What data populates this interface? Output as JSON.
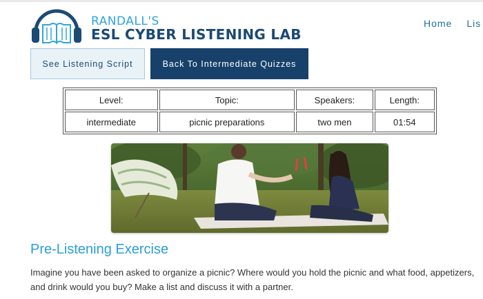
{
  "brand": {
    "top_line": "RANDALL'S",
    "main_line": "ESL CYBER LISTENING LAB"
  },
  "nav": {
    "items": [
      "Home",
      "Lis"
    ]
  },
  "buttons": {
    "script_label": "See Listening Script",
    "back_label": "Back To Intermediate Quizzes"
  },
  "info_table": {
    "headers": [
      "Level:",
      "Topic:",
      "Speakers:",
      "Length:"
    ],
    "values": [
      "intermediate",
      "picnic preparations",
      "two men",
      "01:54"
    ]
  },
  "section": {
    "title": "Pre-Listening Exercise",
    "text": "Imagine you have been asked to organize a picnic? Where would you hold the picnic and what food, appetizers, and drink would you buy? Make a list and discuss it with a partner."
  },
  "colors": {
    "brand_light": "#2fa4dc",
    "brand_dark": "#1b4a74",
    "button_dark": "#17416b",
    "nav_link": "#1e6fa0",
    "section_title": "#2a9fd8"
  }
}
